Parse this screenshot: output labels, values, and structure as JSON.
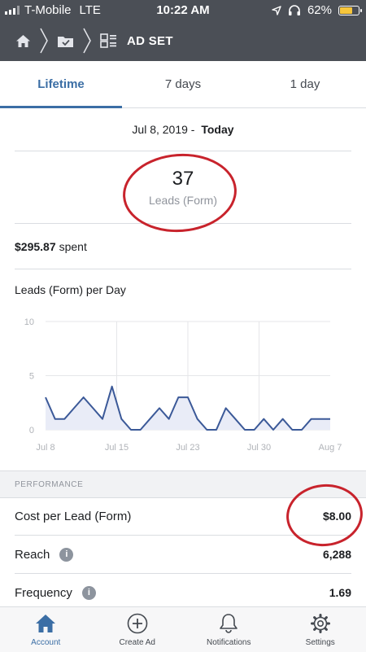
{
  "status_bar": {
    "carrier": "T-Mobile",
    "network": "LTE",
    "time": "10:22 AM",
    "battery": "62%",
    "battery_level": 0.62
  },
  "header": {
    "title": "AD SET",
    "icons": [
      "home-icon",
      "campaign-folder-icon",
      "ad-set-grid-icon"
    ]
  },
  "tabs": [
    {
      "label": "Lifetime",
      "active": true
    },
    {
      "label": "7 days",
      "active": false
    },
    {
      "label": "1 day",
      "active": false
    }
  ],
  "date_range": {
    "start": "Jul 8, 2019 - ",
    "end": "Today"
  },
  "result": {
    "count": "37",
    "label": "Leads (Form)"
  },
  "spent": {
    "amount": "$295.87",
    "suffix": "spent"
  },
  "chart_title": "Leads (Form) per Day",
  "chart_data": {
    "type": "area",
    "title": "Leads (Form) per Day",
    "ylim": [
      0,
      10
    ],
    "yticks": [
      "10",
      "5",
      "0"
    ],
    "xticks": [
      "Jul 8",
      "Jul 15",
      "Jul 23",
      "Jul 30",
      "Aug 7"
    ],
    "values": [
      3,
      1,
      1,
      2,
      3,
      2,
      1,
      4,
      1,
      0,
      0,
      1,
      2,
      1,
      3,
      3,
      1,
      0,
      0,
      2,
      1,
      0,
      0,
      1,
      0,
      1,
      0,
      0,
      1,
      1,
      1
    ],
    "grid": true,
    "colors": {
      "line": "#3b5998",
      "fill": "#e9ecf7",
      "grid": "#e5e6e9"
    }
  },
  "performance": {
    "header": "PERFORMANCE",
    "rows": [
      {
        "label": "Cost per Lead (Form)",
        "value": "$8.00",
        "info": false
      },
      {
        "label": "Reach",
        "value": "6,288",
        "info": true
      },
      {
        "label": "Frequency",
        "value": "1.69",
        "info": true
      }
    ]
  },
  "bottom_nav": [
    {
      "label": "Account",
      "icon": "home-icon",
      "active": true
    },
    {
      "label": "Create Ad",
      "icon": "plus-circle-icon",
      "active": false
    },
    {
      "label": "Notifications",
      "icon": "bell-icon",
      "active": false
    },
    {
      "label": "Settings",
      "icon": "gear-icon",
      "active": false
    }
  ],
  "colors": {
    "header_bg": "#4b4f56",
    "accent": "#3b6ea5",
    "annotation": "#c8232c"
  }
}
